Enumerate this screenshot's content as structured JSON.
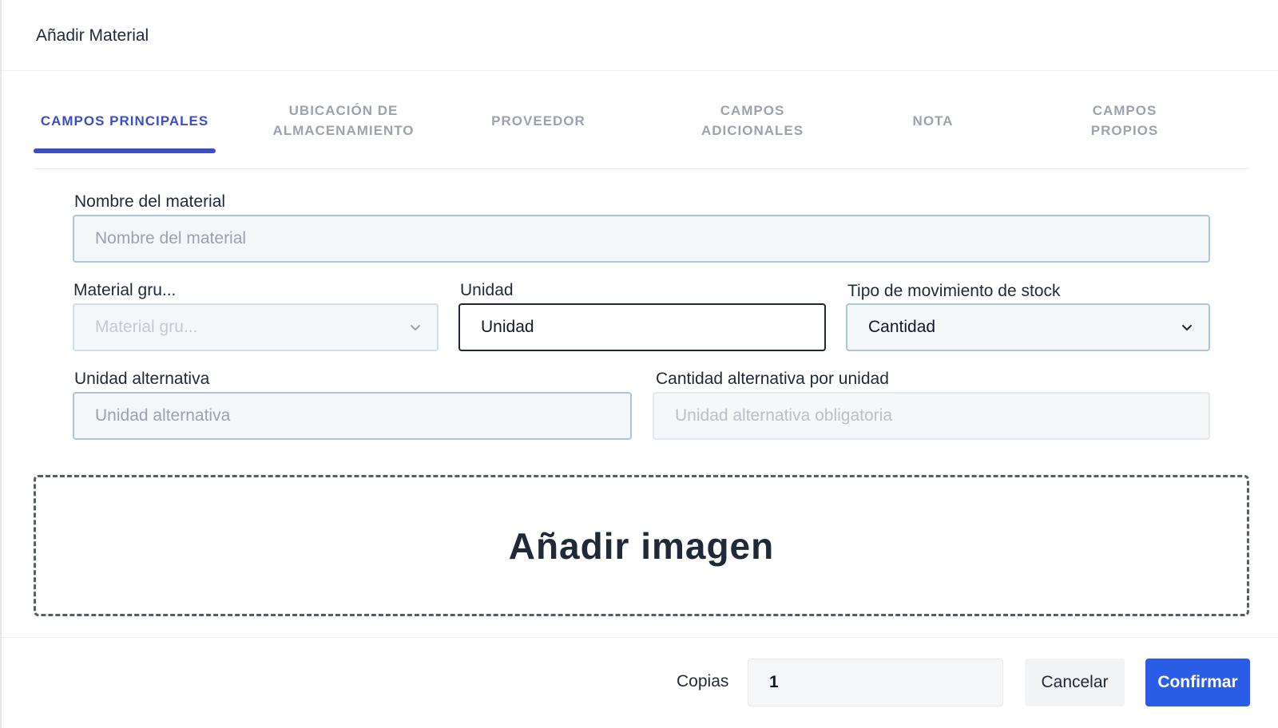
{
  "modal": {
    "title": "Añadir Material"
  },
  "tabs": [
    {
      "label": "CAMPOS PRINCIPALES",
      "active": true
    },
    {
      "label": "UBICACIÓN DE\nALMACENAMIENTO",
      "active": false
    },
    {
      "label": "PROVEEDOR",
      "active": false
    },
    {
      "label": "CAMPOS\nADICIONALES",
      "active": false
    },
    {
      "label": "NOTA",
      "active": false
    },
    {
      "label": "CAMPOS\nPROPIOS",
      "active": false
    }
  ],
  "form": {
    "material_name": {
      "label": "Nombre del material",
      "placeholder": "Nombre del material",
      "value": ""
    },
    "material_group": {
      "label": "Material gru...",
      "placeholder": "Material gru...",
      "value": "",
      "disabled": true
    },
    "unit": {
      "label": "Unidad",
      "value": "Unidad"
    },
    "stock_movement_type": {
      "label": "Tipo de movimiento de stock",
      "value": "Cantidad"
    },
    "alt_unit": {
      "label": "Unidad alternativa",
      "placeholder": "Unidad alternativa",
      "value": ""
    },
    "alt_quantity": {
      "label": "Cantidad alternativa por unidad",
      "placeholder": "Unidad alternativa obligatoria",
      "value": "",
      "disabled": true
    }
  },
  "dropzone": {
    "label": "Añadir imagen"
  },
  "footer": {
    "copies_label": "Copias",
    "copies_value": "1",
    "cancel_label": "Cancelar",
    "confirm_label": "Confirmar"
  },
  "colors": {
    "accent": "#3b4fc4",
    "primary_button": "#2b5ce6",
    "inactive_tab": "#9ca3af"
  }
}
